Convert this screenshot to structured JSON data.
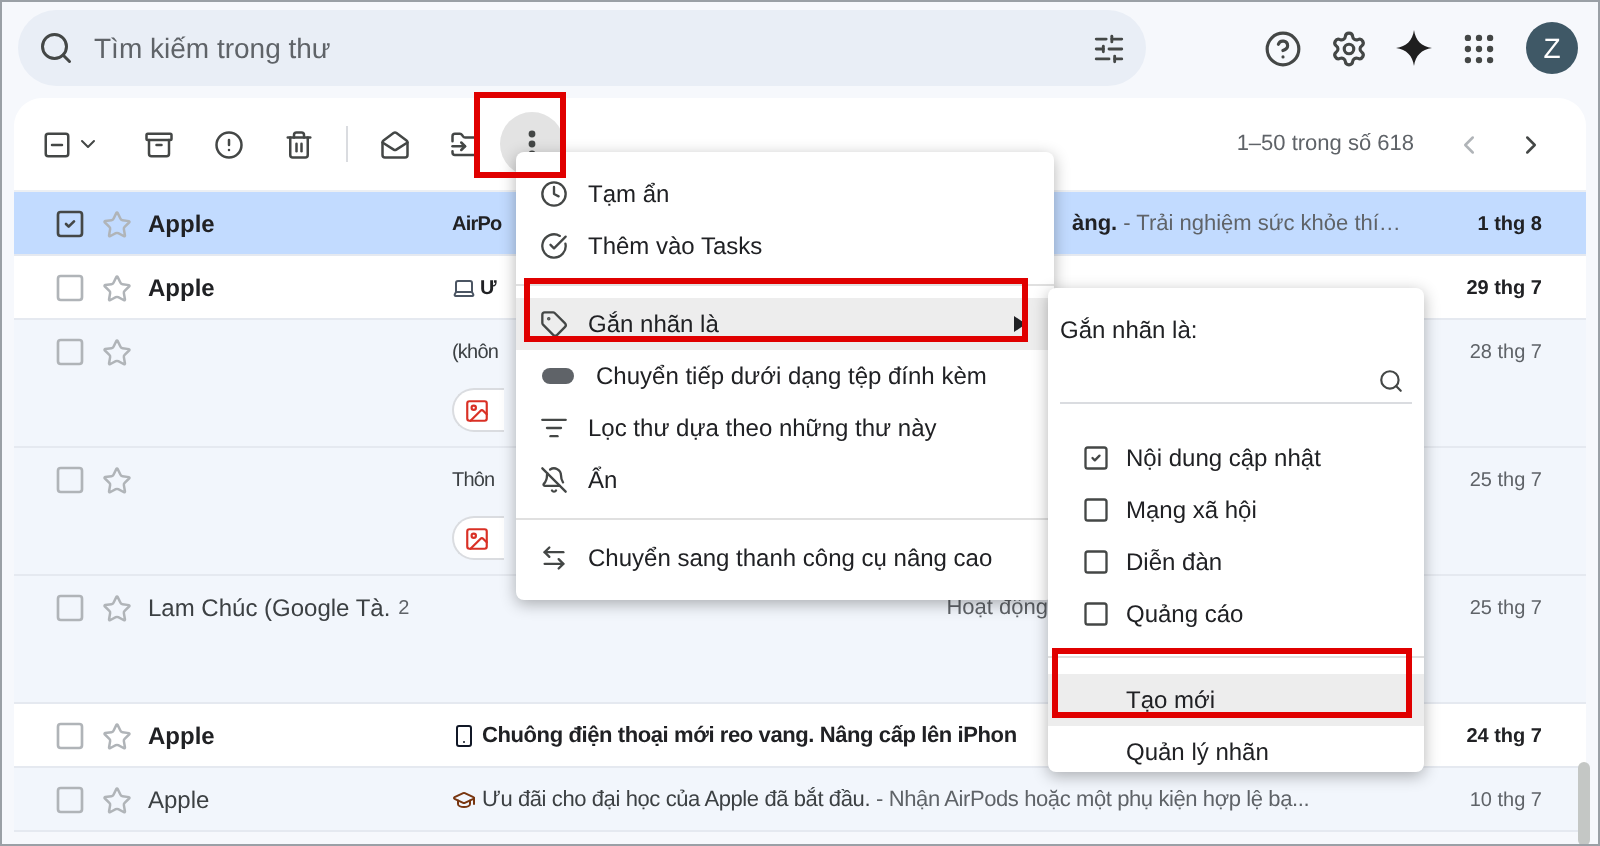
{
  "search": {
    "placeholder": "Tìm kiếm trong thư"
  },
  "account": {
    "initial": "Z"
  },
  "toolbar": {
    "indeterminate": true,
    "pagination": "1–50 trong số 618"
  },
  "emails": [
    {
      "sender": "Apple",
      "unread": true,
      "selected": true,
      "kind": "compact",
      "lead": "AirPo",
      "tail_subject": "àng.",
      "tail_snippet": "- Trải nghiệm sức khỏe thí…",
      "date": "1 thg 8"
    },
    {
      "sender": "Apple",
      "unread": true,
      "selected": false,
      "kind": "compact",
      "lead": "Ư",
      "date": "29 thg 7"
    },
    {
      "unread": false,
      "selected": false,
      "kind": "expanded",
      "lead": "(khôn",
      "attachment": true,
      "date": "28 thg 7"
    },
    {
      "unread": false,
      "selected": false,
      "kind": "expanded",
      "lead": "Thôn",
      "attachment": true,
      "date": "25 thg 7"
    },
    {
      "sender": "Lam Chúc (Google Tà.",
      "count": "2",
      "unread": false,
      "selected": false,
      "kind": "expanded",
      "preview": "Hoạt động",
      "date": "25 thg 7"
    },
    {
      "sender": "Apple",
      "unread": true,
      "selected": false,
      "kind": "compact",
      "subject": "Chuông điện thoại mới reo vang. Nâng cấp lên iPhon",
      "date": "24 thg 7"
    },
    {
      "sender": "Apple",
      "unread": false,
      "selected": false,
      "kind": "compact",
      "subject": "Ưu đãi cho đại học của Apple đã bắt đầu.",
      "snippet": "- Nhận AirPods hoặc một phụ kiện hợp lệ bạ...",
      "date": "10 thg 7"
    }
  ],
  "more_menu": {
    "items": [
      {
        "kind": "snooze",
        "label": "Tạm ẩn",
        "selected": false
      },
      {
        "kind": "task",
        "label": "Thêm vào Tasks",
        "selected": false
      },
      {
        "kind": "divider"
      },
      {
        "kind": "label",
        "label": "Gắn nhãn là",
        "selected": true,
        "submenu": true
      },
      {
        "kind": "forward",
        "label": "Chuyển tiếp dưới dạng tệp đính kèm",
        "selected": false
      },
      {
        "kind": "filter",
        "label": "Lọc thư dựa theo những thư này",
        "selected": false
      },
      {
        "kind": "mute",
        "label": "Ẩn",
        "selected": false
      },
      {
        "kind": "divider"
      },
      {
        "kind": "switch",
        "label": "Chuyển sang thanh công cụ nâng cao",
        "selected": false
      }
    ]
  },
  "label_menu": {
    "title": "Gắn nhãn là:",
    "labels": [
      {
        "label": "Nội dung cập nhật",
        "checked": true
      },
      {
        "label": "Mạng xã hội",
        "checked": false
      },
      {
        "label": "Diễn đàn",
        "checked": false
      },
      {
        "label": "Quảng cáo",
        "checked": false
      }
    ],
    "actions": [
      {
        "label": "Tạo mới",
        "selected": true
      },
      {
        "label": "Quản lý nhãn",
        "selected": false
      }
    ]
  }
}
